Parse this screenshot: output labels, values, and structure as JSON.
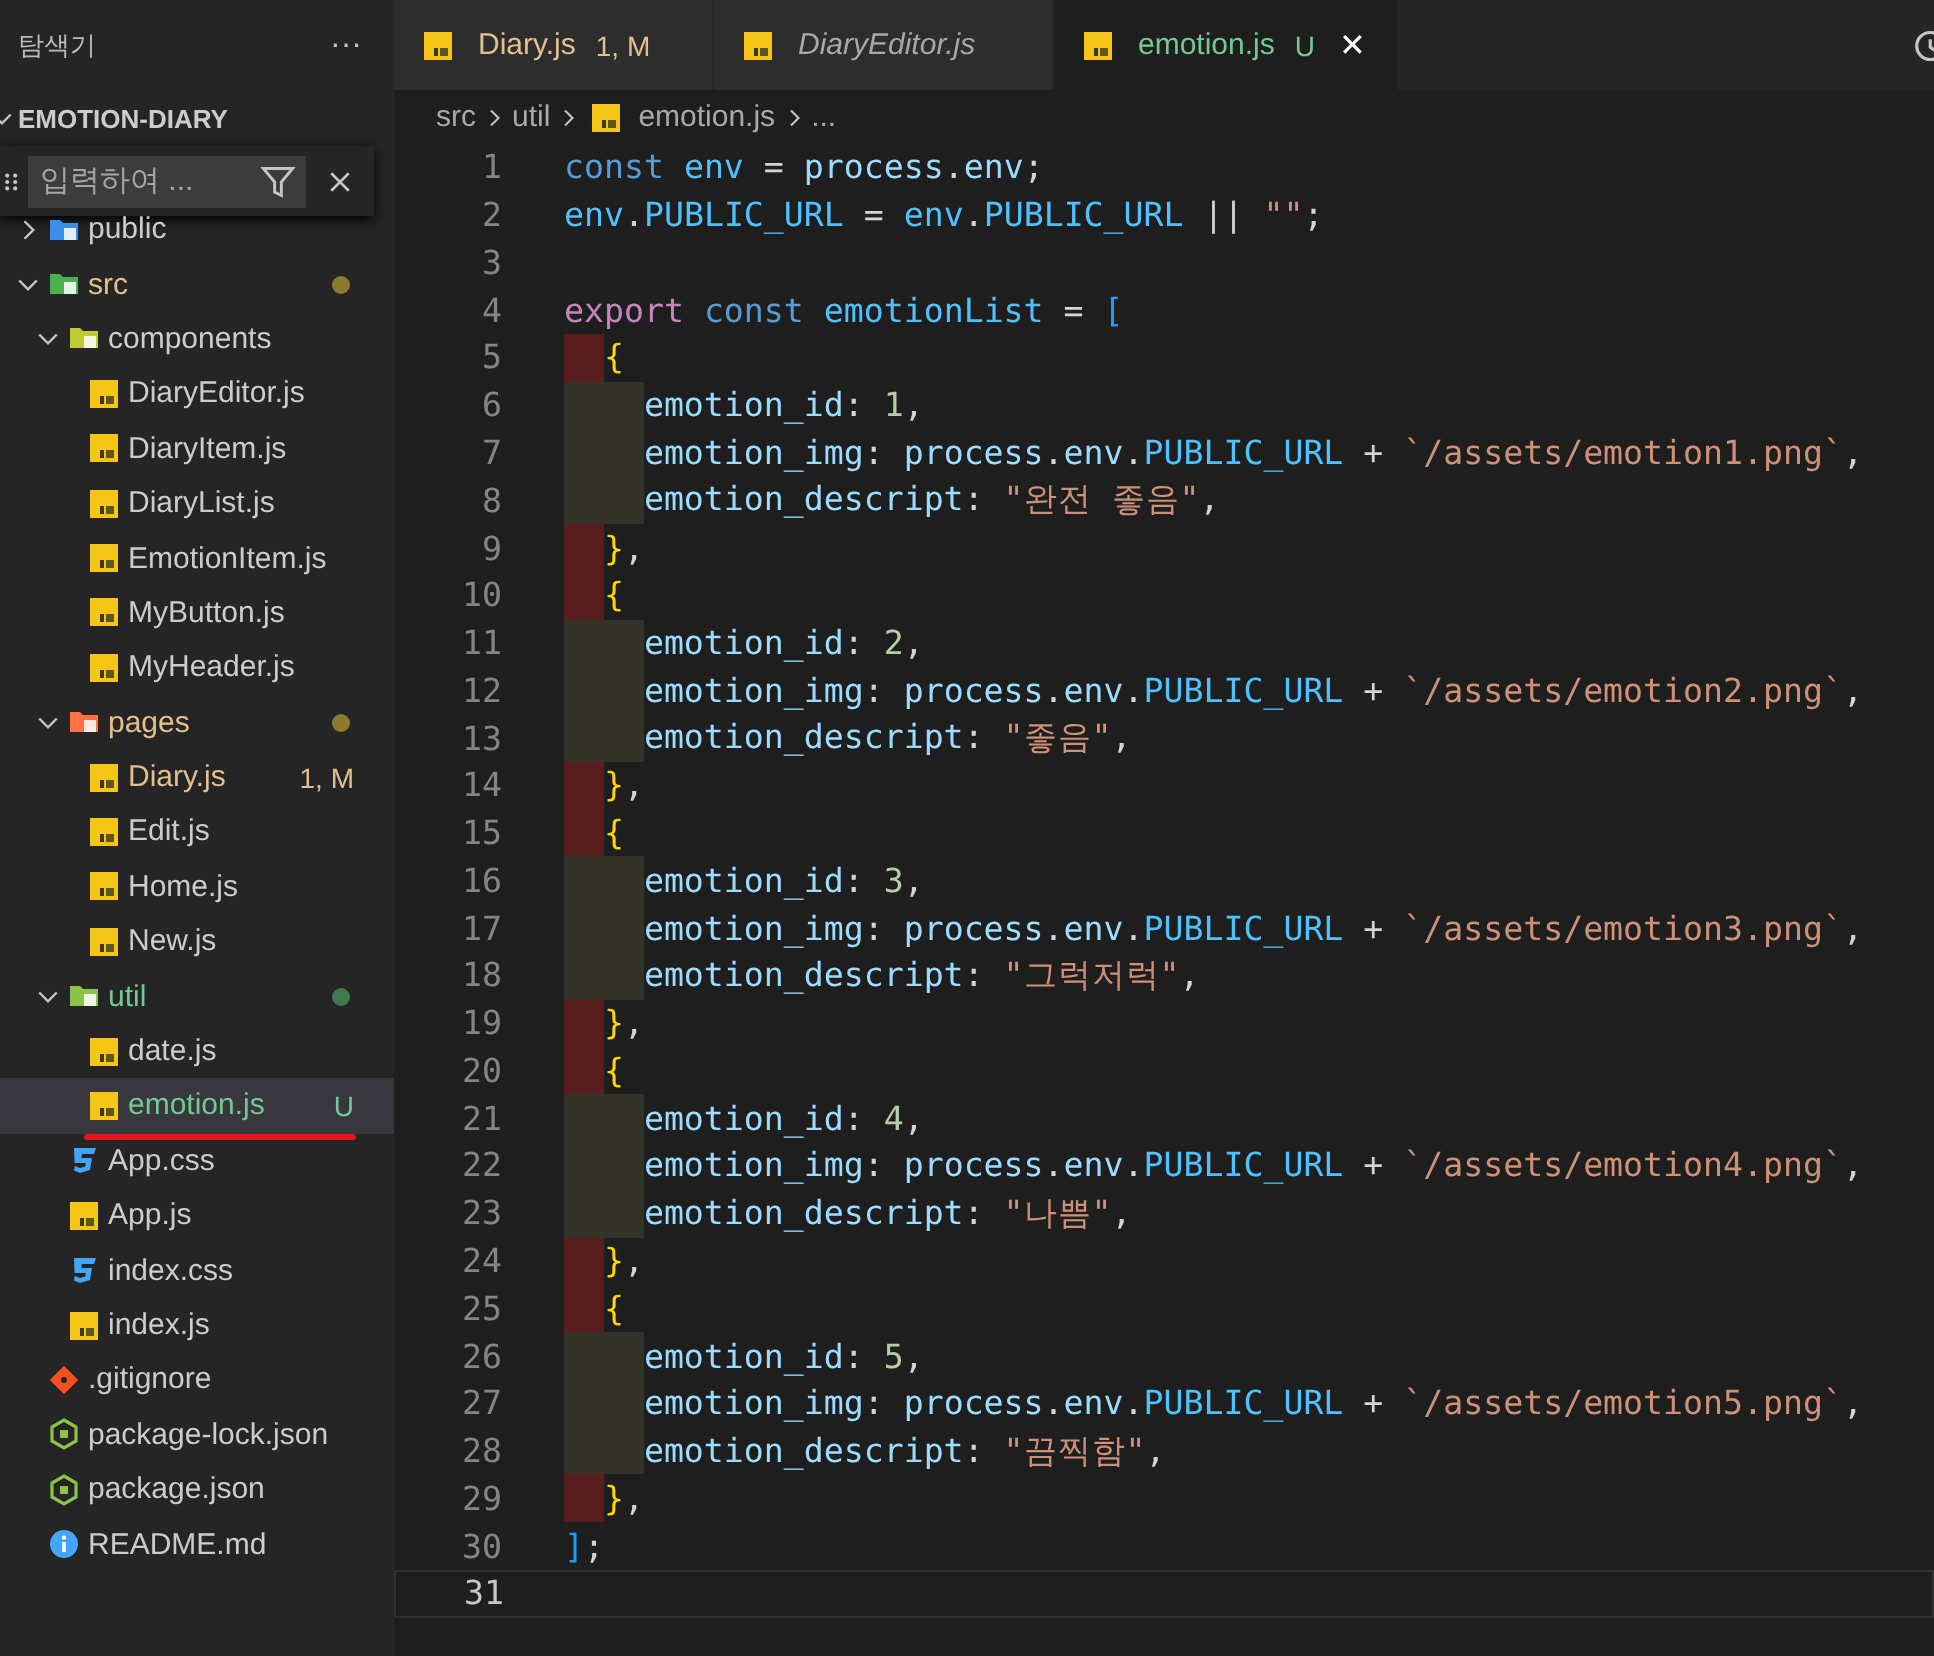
{
  "sidebar": {
    "title": "탐색기",
    "more": "···",
    "section": "EMOTION-DIARY",
    "filter": {
      "placeholder": "입력하여 ..."
    },
    "tree": [
      {
        "name": "public",
        "kind": "folder",
        "color": "#3b8eea",
        "expanded": false,
        "selected": false,
        "modified": false,
        "untracked": false
      },
      {
        "name": "src",
        "kind": "folder",
        "color": "#4caf50",
        "expanded": true,
        "selected": false,
        "modified": true,
        "untracked": false,
        "children": [
          {
            "name": "components",
            "kind": "folder",
            "color": "#c0ca33",
            "expanded": true,
            "selected": false,
            "modified": false,
            "untracked": false,
            "children": [
              {
                "name": "DiaryEditor.js",
                "kind": "js",
                "selected": false,
                "modified": false,
                "untracked": false
              },
              {
                "name": "DiaryItem.js",
                "kind": "js",
                "selected": false,
                "modified": false,
                "untracked": false
              },
              {
                "name": "DiaryList.js",
                "kind": "js",
                "selected": false,
                "modified": false,
                "untracked": false
              },
              {
                "name": "EmotionItem.js",
                "kind": "js",
                "selected": false,
                "modified": false,
                "untracked": false
              },
              {
                "name": "MyButton.js",
                "kind": "js",
                "selected": false,
                "modified": false,
                "untracked": false
              },
              {
                "name": "MyHeader.js",
                "kind": "js",
                "selected": false,
                "modified": false,
                "untracked": false
              }
            ]
          },
          {
            "name": "pages",
            "kind": "folder",
            "color": "#ff7043",
            "expanded": true,
            "selected": false,
            "modified": true,
            "untracked": false,
            "children": [
              {
                "name": "Diary.js",
                "kind": "js",
                "selected": false,
                "modified": true,
                "untracked": false,
                "badge": "1, M"
              },
              {
                "name": "Edit.js",
                "kind": "js",
                "selected": false,
                "modified": false,
                "untracked": false
              },
              {
                "name": "Home.js",
                "kind": "js",
                "selected": false,
                "modified": false,
                "untracked": false
              },
              {
                "name": "New.js",
                "kind": "js",
                "selected": false,
                "modified": false,
                "untracked": false
              }
            ]
          },
          {
            "name": "util",
            "kind": "folder",
            "color": "#8bc34a",
            "expanded": true,
            "selected": false,
            "modified": false,
            "untracked": true,
            "children": [
              {
                "name": "date.js",
                "kind": "js",
                "selected": false,
                "modified": false,
                "untracked": false
              },
              {
                "name": "emotion.js",
                "kind": "js",
                "selected": true,
                "modified": false,
                "untracked": true,
                "badge": "U",
                "underlined": true
              }
            ]
          },
          {
            "name": "App.css",
            "kind": "css",
            "selected": false,
            "modified": false,
            "untracked": false
          },
          {
            "name": "App.js",
            "kind": "js",
            "selected": false,
            "modified": false,
            "untracked": false
          },
          {
            "name": "index.css",
            "kind": "css",
            "selected": false,
            "modified": false,
            "untracked": false
          },
          {
            "name": "index.js",
            "kind": "js",
            "selected": false,
            "modified": false,
            "untracked": false
          }
        ]
      },
      {
        "name": ".gitignore",
        "kind": "git",
        "selected": false,
        "modified": false,
        "untracked": false
      },
      {
        "name": "package-lock.json",
        "kind": "node",
        "selected": false,
        "modified": false,
        "untracked": false
      },
      {
        "name": "package.json",
        "kind": "node",
        "selected": false,
        "modified": false,
        "untracked": false
      },
      {
        "name": "README.md",
        "kind": "info",
        "selected": false,
        "modified": false,
        "untracked": false
      }
    ]
  },
  "tabs": [
    {
      "label": "Diary.js",
      "selected": false,
      "preview": false,
      "modified": true,
      "untracked": false,
      "badge": "1, M"
    },
    {
      "label": "DiaryEditor.js",
      "selected": false,
      "preview": true,
      "modified": false,
      "untracked": false
    },
    {
      "label": "emotion.js",
      "selected": true,
      "preview": false,
      "modified": false,
      "untracked": true,
      "badge": "U",
      "close": "✕"
    }
  ],
  "breadcrumb": [
    "src",
    "util",
    "emotion.js",
    "..."
  ],
  "code": [
    {
      "n": "1",
      "kind": "plain",
      "tokens": [
        {
          "text": "const ",
          "kind": "storage"
        },
        {
          "text": "env",
          "kind": "const"
        },
        {
          "text": " = ",
          "kind": "plain"
        },
        {
          "text": "process",
          "kind": "var"
        },
        {
          "text": ".",
          "kind": "plain"
        },
        {
          "text": "env",
          "kind": "var"
        },
        {
          "text": ";",
          "kind": "plain"
        }
      ]
    },
    {
      "n": "2",
      "kind": "plain",
      "tokens": [
        {
          "text": "env",
          "kind": "const"
        },
        {
          "text": ".",
          "kind": "plain"
        },
        {
          "text": "PUBLIC_URL",
          "kind": "const"
        },
        {
          "text": " = ",
          "kind": "plain"
        },
        {
          "text": "env",
          "kind": "const"
        },
        {
          "text": ".",
          "kind": "plain"
        },
        {
          "text": "PUBLIC_URL",
          "kind": "const"
        },
        {
          "text": " || ",
          "kind": "plain"
        },
        {
          "text": "\"\"",
          "kind": "str"
        },
        {
          "text": ";",
          "kind": "plain"
        }
      ]
    },
    {
      "n": "3",
      "kind": "plain"
    },
    {
      "n": "4",
      "kind": "plain",
      "tokens": [
        {
          "text": "export ",
          "kind": "keyword"
        },
        {
          "text": "const ",
          "kind": "storage"
        },
        {
          "text": "emotionList",
          "kind": "const"
        },
        {
          "text": " = ",
          "kind": "plain"
        },
        {
          "text": "[",
          "kind": "bracket2"
        }
      ]
    },
    {
      "n": "5",
      "kind": "brace",
      "tokens": [
        {
          "text": "{",
          "kind": "bracket1"
        }
      ]
    },
    {
      "n": "6",
      "kind": "body",
      "tokens": [
        {
          "text": "emotion_id",
          "kind": "var"
        },
        {
          "text": ": ",
          "kind": "plain"
        },
        {
          "text": "1",
          "kind": "num"
        },
        {
          "text": ",",
          "kind": "plain"
        }
      ]
    },
    {
      "n": "7",
      "kind": "body",
      "tokens": [
        {
          "text": "emotion_img",
          "kind": "var"
        },
        {
          "text": ": ",
          "kind": "plain"
        },
        {
          "text": "process",
          "kind": "var"
        },
        {
          "text": ".",
          "kind": "plain"
        },
        {
          "text": "env",
          "kind": "var"
        },
        {
          "text": ".",
          "kind": "plain"
        },
        {
          "text": "PUBLIC_URL",
          "kind": "const"
        },
        {
          "text": " + ",
          "kind": "plain"
        },
        {
          "text": "`/assets/emotion1.png`",
          "kind": "str"
        },
        {
          "text": ",",
          "kind": "plain"
        }
      ]
    },
    {
      "n": "8",
      "kind": "body",
      "tokens": [
        {
          "text": "emotion_descript",
          "kind": "var"
        },
        {
          "text": ": ",
          "kind": "plain"
        },
        {
          "text": "\"완전 좋음\"",
          "kind": "str"
        },
        {
          "text": ",",
          "kind": "plain"
        }
      ]
    },
    {
      "n": "9",
      "kind": "brace",
      "tokens": [
        {
          "text": "}",
          "kind": "bracket1"
        },
        {
          "text": ",",
          "kind": "plain"
        }
      ]
    },
    {
      "n": "10",
      "kind": "brace",
      "tokens": [
        {
          "text": "{",
          "kind": "bracket1"
        }
      ]
    },
    {
      "n": "11",
      "kind": "body",
      "tokens": [
        {
          "text": "emotion_id",
          "kind": "var"
        },
        {
          "text": ": ",
          "kind": "plain"
        },
        {
          "text": "2",
          "kind": "num"
        },
        {
          "text": ",",
          "kind": "plain"
        }
      ]
    },
    {
      "n": "12",
      "kind": "body",
      "tokens": [
        {
          "text": "emotion_img",
          "kind": "var"
        },
        {
          "text": ": ",
          "kind": "plain"
        },
        {
          "text": "process",
          "kind": "var"
        },
        {
          "text": ".",
          "kind": "plain"
        },
        {
          "text": "env",
          "kind": "var"
        },
        {
          "text": ".",
          "kind": "plain"
        },
        {
          "text": "PUBLIC_URL",
          "kind": "const"
        },
        {
          "text": " + ",
          "kind": "plain"
        },
        {
          "text": "`/assets/emotion2.png`",
          "kind": "str"
        },
        {
          "text": ",",
          "kind": "plain"
        }
      ]
    },
    {
      "n": "13",
      "kind": "body",
      "tokens": [
        {
          "text": "emotion_descript",
          "kind": "var"
        },
        {
          "text": ": ",
          "kind": "plain"
        },
        {
          "text": "\"좋음\"",
          "kind": "str"
        },
        {
          "text": ",",
          "kind": "plain"
        }
      ]
    },
    {
      "n": "14",
      "kind": "brace",
      "tokens": [
        {
          "text": "}",
          "kind": "bracket1"
        },
        {
          "text": ",",
          "kind": "plain"
        }
      ]
    },
    {
      "n": "15",
      "kind": "brace",
      "tokens": [
        {
          "text": "{",
          "kind": "bracket1"
        }
      ]
    },
    {
      "n": "16",
      "kind": "body",
      "tokens": [
        {
          "text": "emotion_id",
          "kind": "var"
        },
        {
          "text": ": ",
          "kind": "plain"
        },
        {
          "text": "3",
          "kind": "num"
        },
        {
          "text": ",",
          "kind": "plain"
        }
      ]
    },
    {
      "n": "17",
      "kind": "body",
      "tokens": [
        {
          "text": "emotion_img",
          "kind": "var"
        },
        {
          "text": ": ",
          "kind": "plain"
        },
        {
          "text": "process",
          "kind": "var"
        },
        {
          "text": ".",
          "kind": "plain"
        },
        {
          "text": "env",
          "kind": "var"
        },
        {
          "text": ".",
          "kind": "plain"
        },
        {
          "text": "PUBLIC_URL",
          "kind": "const"
        },
        {
          "text": " + ",
          "kind": "plain"
        },
        {
          "text": "`/assets/emotion3.png`",
          "kind": "str"
        },
        {
          "text": ",",
          "kind": "plain"
        }
      ]
    },
    {
      "n": "18",
      "kind": "body",
      "tokens": [
        {
          "text": "emotion_descript",
          "kind": "var"
        },
        {
          "text": ": ",
          "kind": "plain"
        },
        {
          "text": "\"그럭저럭\"",
          "kind": "str"
        },
        {
          "text": ",",
          "kind": "plain"
        }
      ]
    },
    {
      "n": "19",
      "kind": "brace",
      "tokens": [
        {
          "text": "}",
          "kind": "bracket1"
        },
        {
          "text": ",",
          "kind": "plain"
        }
      ]
    },
    {
      "n": "20",
      "kind": "brace",
      "tokens": [
        {
          "text": "{",
          "kind": "bracket1"
        }
      ]
    },
    {
      "n": "21",
      "kind": "body",
      "tokens": [
        {
          "text": "emotion_id",
          "kind": "var"
        },
        {
          "text": ": ",
          "kind": "plain"
        },
        {
          "text": "4",
          "kind": "num"
        },
        {
          "text": ",",
          "kind": "plain"
        }
      ]
    },
    {
      "n": "22",
      "kind": "body",
      "tokens": [
        {
          "text": "emotion_img",
          "kind": "var"
        },
        {
          "text": ": ",
          "kind": "plain"
        },
        {
          "text": "process",
          "kind": "var"
        },
        {
          "text": ".",
          "kind": "plain"
        },
        {
          "text": "env",
          "kind": "var"
        },
        {
          "text": ".",
          "kind": "plain"
        },
        {
          "text": "PUBLIC_URL",
          "kind": "const"
        },
        {
          "text": " + ",
          "kind": "plain"
        },
        {
          "text": "`/assets/emotion4.png`",
          "kind": "str"
        },
        {
          "text": ",",
          "kind": "plain"
        }
      ]
    },
    {
      "n": "23",
      "kind": "body",
      "tokens": [
        {
          "text": "emotion_descript",
          "kind": "var"
        },
        {
          "text": ": ",
          "kind": "plain"
        },
        {
          "text": "\"나쁨\"",
          "kind": "str"
        },
        {
          "text": ",",
          "kind": "plain"
        }
      ]
    },
    {
      "n": "24",
      "kind": "brace",
      "tokens": [
        {
          "text": "}",
          "kind": "bracket1"
        },
        {
          "text": ",",
          "kind": "plain"
        }
      ]
    },
    {
      "n": "25",
      "kind": "brace",
      "tokens": [
        {
          "text": "{",
          "kind": "bracket1"
        }
      ]
    },
    {
      "n": "26",
      "kind": "body",
      "tokens": [
        {
          "text": "emotion_id",
          "kind": "var"
        },
        {
          "text": ": ",
          "kind": "plain"
        },
        {
          "text": "5",
          "kind": "num"
        },
        {
          "text": ",",
          "kind": "plain"
        }
      ]
    },
    {
      "n": "27",
      "kind": "body",
      "tokens": [
        {
          "text": "emotion_img",
          "kind": "var"
        },
        {
          "text": ": ",
          "kind": "plain"
        },
        {
          "text": "process",
          "kind": "var"
        },
        {
          "text": ".",
          "kind": "plain"
        },
        {
          "text": "env",
          "kind": "var"
        },
        {
          "text": ".",
          "kind": "plain"
        },
        {
          "text": "PUBLIC_URL",
          "kind": "const"
        },
        {
          "text": " + ",
          "kind": "plain"
        },
        {
          "text": "`/assets/emotion5.png`",
          "kind": "str"
        },
        {
          "text": ",",
          "kind": "plain"
        }
      ]
    },
    {
      "n": "28",
      "kind": "body",
      "tokens": [
        {
          "text": "emotion_descript",
          "kind": "var"
        },
        {
          "text": ": ",
          "kind": "plain"
        },
        {
          "text": "\"끔찍함\"",
          "kind": "str"
        },
        {
          "text": ",",
          "kind": "plain"
        }
      ]
    },
    {
      "n": "29",
      "kind": "brace",
      "tokens": [
        {
          "text": "}",
          "kind": "bracket1"
        },
        {
          "text": ",",
          "kind": "plain"
        }
      ]
    },
    {
      "n": "30",
      "kind": "plain",
      "tokens": [
        {
          "text": "]",
          "kind": "bracket2"
        },
        {
          "text": ";",
          "kind": "plain"
        }
      ]
    },
    {
      "n": "31",
      "kind": "plain",
      "current": true
    }
  ]
}
